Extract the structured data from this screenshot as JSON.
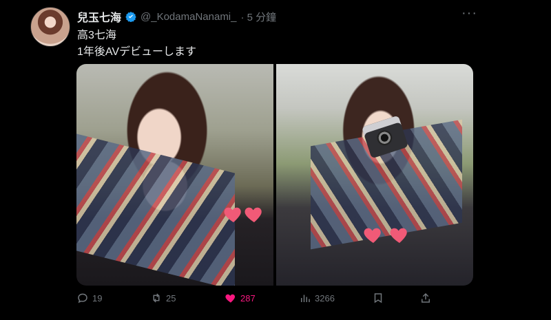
{
  "tweet": {
    "display_name": "兒玉七海",
    "handle": "@_KodamaNanami_",
    "time": "· 5 分鐘",
    "more": "···",
    "text_line1": "高3七海",
    "text_line2": "1年後AVデビューします"
  },
  "actions": {
    "reply_count": "19",
    "retweet_count": "25",
    "like_count": "287",
    "views_count": "3266"
  },
  "colors": {
    "accent_like": "#f91880",
    "verified": "#1d9bf0",
    "muted": "#71767b"
  },
  "icons": [
    "verified-badge-icon",
    "more-icon",
    "reply-icon",
    "retweet-icon",
    "heart-icon",
    "views-icon",
    "bookmark-icon",
    "share-icon"
  ]
}
